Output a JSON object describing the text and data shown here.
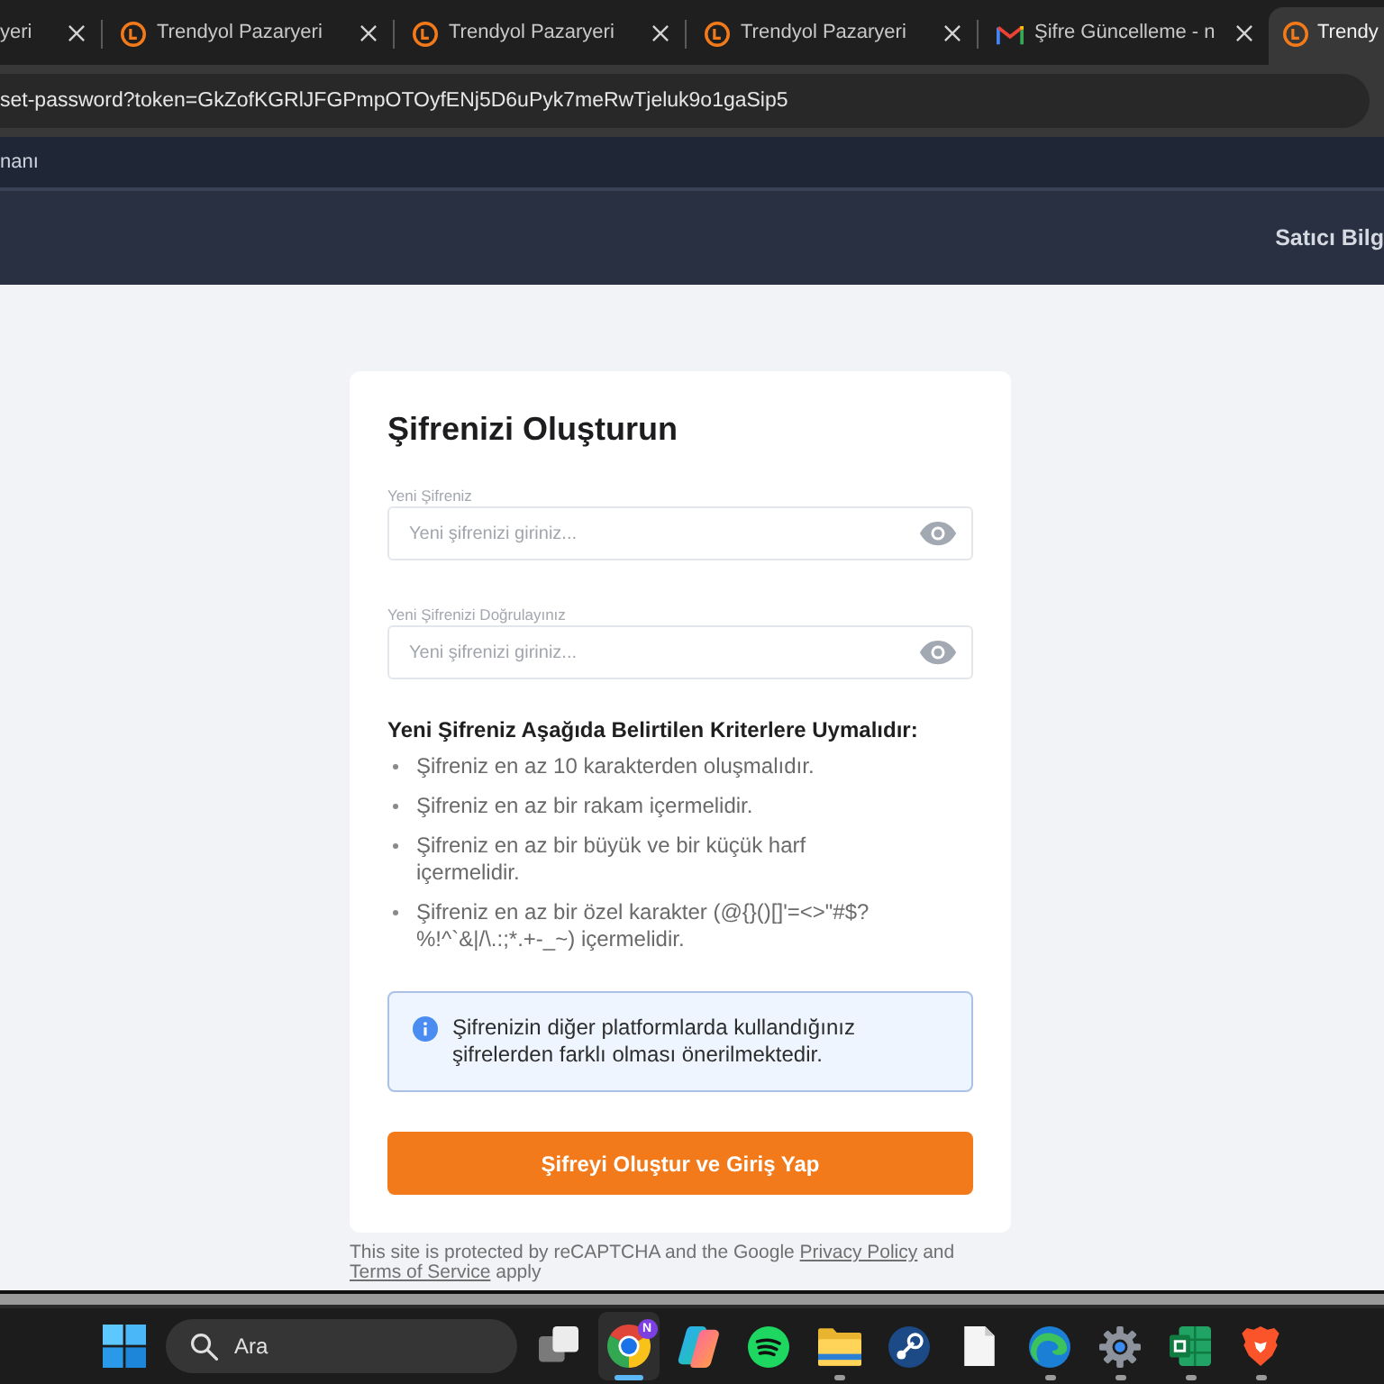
{
  "browser": {
    "tabs": [
      {
        "kind": "cut",
        "title": "yeri",
        "selected": false
      },
      {
        "kind": "ring",
        "title": "Trendyol Pazaryeri",
        "selected": false
      },
      {
        "kind": "ring",
        "title": "Trendyol Pazaryeri",
        "selected": false
      },
      {
        "kind": "ring",
        "title": "Trendyol Pazaryeri",
        "selected": false
      },
      {
        "kind": "mail",
        "title": "Şifre Güncelleme - n",
        "selected": false
      },
      {
        "kind": "ring",
        "title": "Trendy",
        "selected": true
      }
    ],
    "address": "set-password?token=GkZofKGRlJFGPmpOTOyfENj5D6uPyk7meRwTjeluk9o1gaSip5"
  },
  "site": {
    "top_bar_link": "nanı",
    "header_link": "Satıcı Bilg"
  },
  "form": {
    "title": "Şifrenizi Oluşturun",
    "fields": [
      {
        "label": "Yeni Şifreniz",
        "placeholder": "Yeni şifrenizi giriniz..."
      },
      {
        "label": "Yeni Şifrenizi Doğrulayınız",
        "placeholder": "Yeni şifrenizi giriniz..."
      }
    ],
    "criteria_title": "Yeni Şifreniz Aşağıda Belirtilen Kriterlere Uymalıdır:",
    "criteria": [
      "Şifreniz en az 10 karakterden oluşmalıdır.",
      "Şifreniz en az bir rakam içermelidir.",
      "Şifreniz en az bir büyük ve bir küçük harf içermelidir.",
      "Şifreniz en az bir özel karakter (@{}()[]'=<>\"#$?%!^`&|/\\.:;*.+-_~) içermelidir."
    ],
    "info": "Şifrenizin diğer platformlarda kullandığınız şifrelerden farklı olması önerilmektedir.",
    "submit": "Şifreyi Oluştur ve Giriş Yap"
  },
  "footer": [
    {
      "kind": "text",
      "text": "This site is protected by reCAPTCHA and the Google"
    },
    {
      "kind": "link",
      "text": "Privacy Policy"
    },
    {
      "kind": "text",
      "text": "and"
    },
    {
      "kind": "link",
      "text": "Terms of Service"
    },
    {
      "kind": "text",
      "text": "apply"
    }
  ],
  "taskbar": {
    "search_placeholder": "Ara",
    "apps": [
      {
        "kind": "task-view",
        "running": false,
        "active": false
      },
      {
        "kind": "ring",
        "running": true,
        "active": true,
        "badge": "N"
      },
      {
        "kind": "swirl",
        "running": false,
        "active": false
      },
      {
        "kind": "waves",
        "running": false,
        "active": false
      },
      {
        "kind": "folder",
        "running": true,
        "active": false
      },
      {
        "kind": "disc",
        "running": false,
        "active": false
      },
      {
        "kind": "document",
        "running": false,
        "active": false
      },
      {
        "kind": "wave",
        "running": true,
        "active": false
      },
      {
        "kind": "gear",
        "running": true,
        "active": false
      },
      {
        "kind": "sheet",
        "running": true,
        "active": false
      },
      {
        "kind": "shield",
        "running": true,
        "active": false
      }
    ]
  }
}
